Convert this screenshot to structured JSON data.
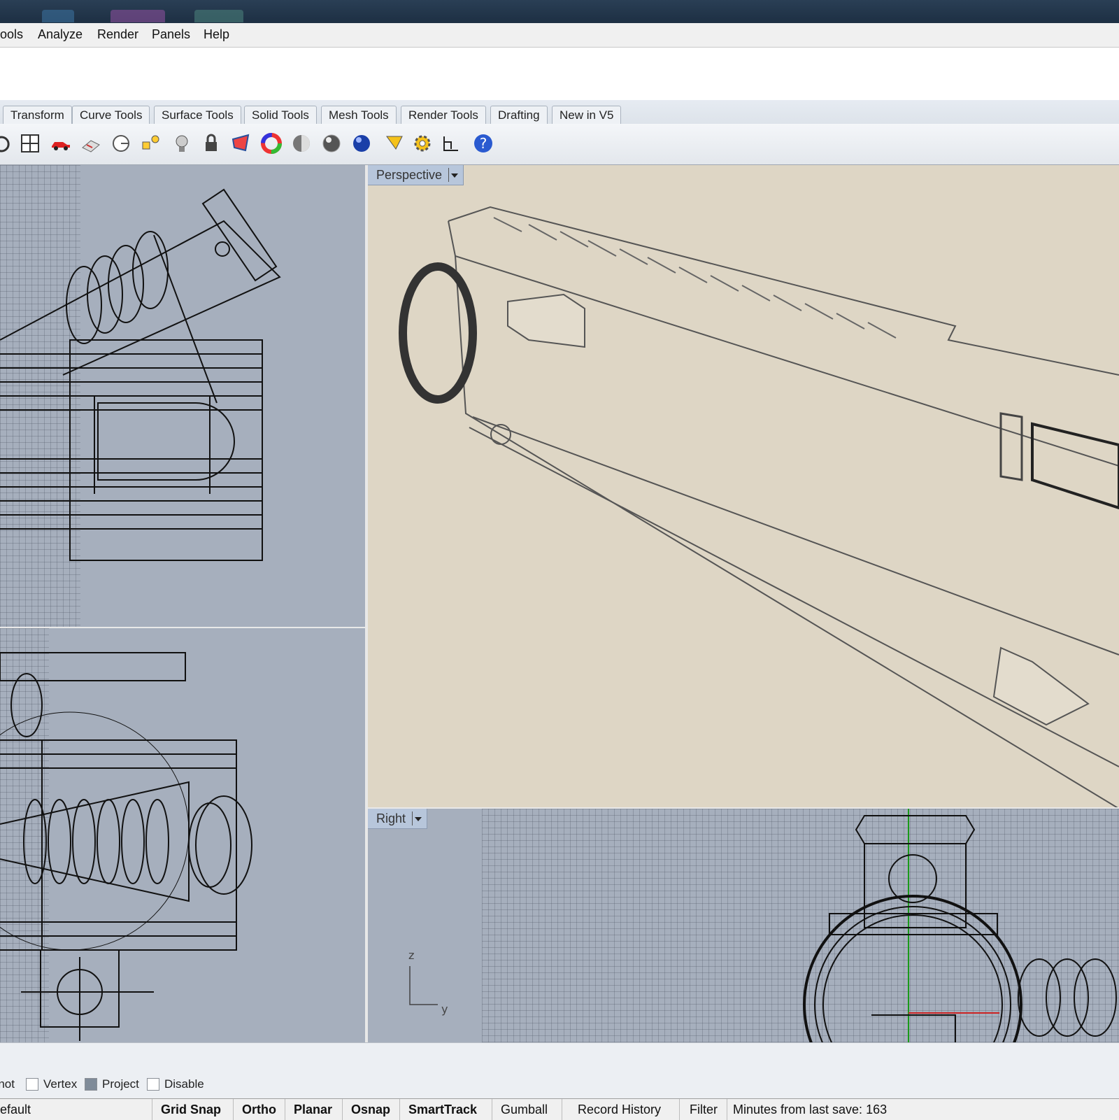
{
  "menu": {
    "items": [
      "ools",
      "Analyze",
      "Render",
      "Panels",
      "Help"
    ]
  },
  "tabs": [
    "Transform",
    "Curve Tools",
    "Surface Tools",
    "Solid Tools",
    "Mesh Tools",
    "Render Tools",
    "Drafting",
    "New in V5"
  ],
  "toolbar": {
    "icons": [
      "undo-icon",
      "viewport-layout-icon",
      "car-icon",
      "plan-view-icon",
      "rotate-view-icon",
      "shapes-icon",
      "light-bulb-icon",
      "lock-icon",
      "material-icon",
      "color-wheel-icon",
      "shaded-sphere-icon",
      "rendered-sphere-icon",
      "blue-sphere-icon",
      "funnel-icon",
      "gear-icon",
      "dimension-icon",
      "help-icon"
    ]
  },
  "viewports": {
    "perspective_label": "Perspective",
    "right_label": "Right",
    "axis_z": "z",
    "axis_y": "y"
  },
  "osnap": {
    "knot": "Knot",
    "vertex": "Vertex",
    "project": "Project",
    "disable": "Disable"
  },
  "status": {
    "layer": "efault",
    "grid_snap": "Grid Snap",
    "ortho": "Ortho",
    "planar": "Planar",
    "osnap": "Osnap",
    "smarttrack": "SmartTrack",
    "gumball": "Gumball",
    "record_history": "Record History",
    "filter": "Filter",
    "save_info": "Minutes from last save: 163"
  },
  "colors": {
    "viewport_bg": "#a6afbd",
    "perspective_bg": "#ded6c5",
    "label_bg": "#b7c6db"
  }
}
